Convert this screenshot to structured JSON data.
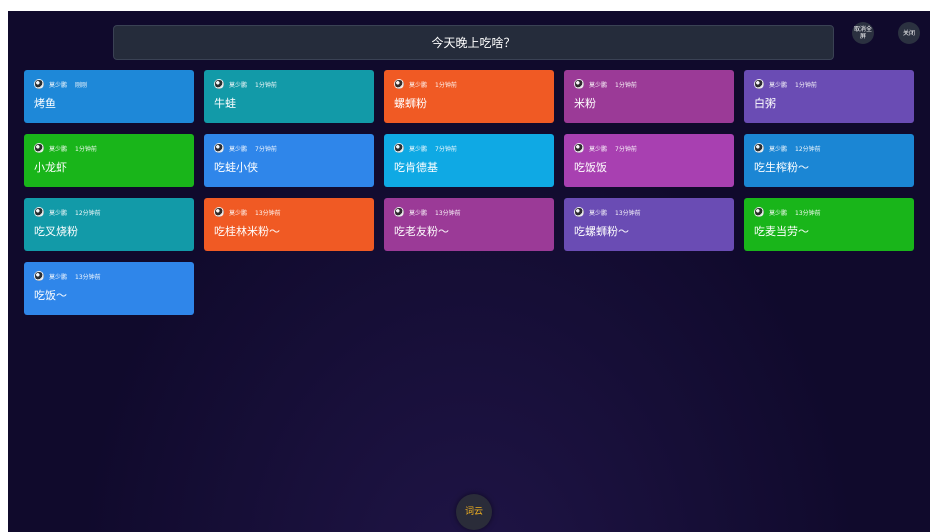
{
  "header": {
    "topic": "今天晚上吃啥？",
    "fullscreen_label": "取消全屏",
    "close_label": "关闭"
  },
  "cards": [
    {
      "name": "莫少鹏",
      "time": "刚刚",
      "text": "烤鱼",
      "color": "#1e88d8"
    },
    {
      "name": "莫少鹏",
      "time": "1分钟前",
      "text": "牛蛙",
      "color": "#129aa8"
    },
    {
      "name": "莫少鹏",
      "time": "1分钟前",
      "text": "螺蛳粉",
      "color": "#f05a24"
    },
    {
      "name": "莫少鹏",
      "time": "1分钟前",
      "text": "米粉",
      "color": "#9b3a97"
    },
    {
      "name": "莫少鹏",
      "time": "1分钟前",
      "text": "白粥",
      "color": "#6a4cb4"
    },
    {
      "name": "莫少鹏",
      "time": "1分钟前",
      "text": "小龙虾",
      "color": "#19b51a"
    },
    {
      "name": "莫少鹏",
      "time": "7分钟前",
      "text": "吃蛙小侠",
      "color": "#2f86ea"
    },
    {
      "name": "莫少鹏",
      "time": "7分钟前",
      "text": "吃肯德基",
      "color": "#0fa9e4"
    },
    {
      "name": "莫少鹏",
      "time": "7分钟前",
      "text": "吃饭饭",
      "color": "#a840b1"
    },
    {
      "name": "莫少鹏",
      "time": "12分钟前",
      "text": "吃生榨粉～",
      "color": "#1b86d4"
    },
    {
      "name": "莫少鹏",
      "time": "12分钟前",
      "text": "吃叉烧粉",
      "color": "#129aa8"
    },
    {
      "name": "莫少鹏",
      "time": "13分钟前",
      "text": "吃桂林米粉～",
      "color": "#f05a24"
    },
    {
      "name": "莫少鹏",
      "time": "13分钟前",
      "text": "吃老友粉～",
      "color": "#9b3a97"
    },
    {
      "name": "莫少鹏",
      "time": "13分钟前",
      "text": "吃螺蛳粉～",
      "color": "#6a4cb4"
    },
    {
      "name": "莫少鹏",
      "time": "13分钟前",
      "text": "吃麦当劳～",
      "color": "#19b51a"
    },
    {
      "name": "莫少鹏",
      "time": "13分钟前",
      "text": "吃饭～",
      "color": "#2f86ea"
    }
  ],
  "footer": {
    "wordcloud_label": "词云",
    "accent": "#f0b020"
  }
}
